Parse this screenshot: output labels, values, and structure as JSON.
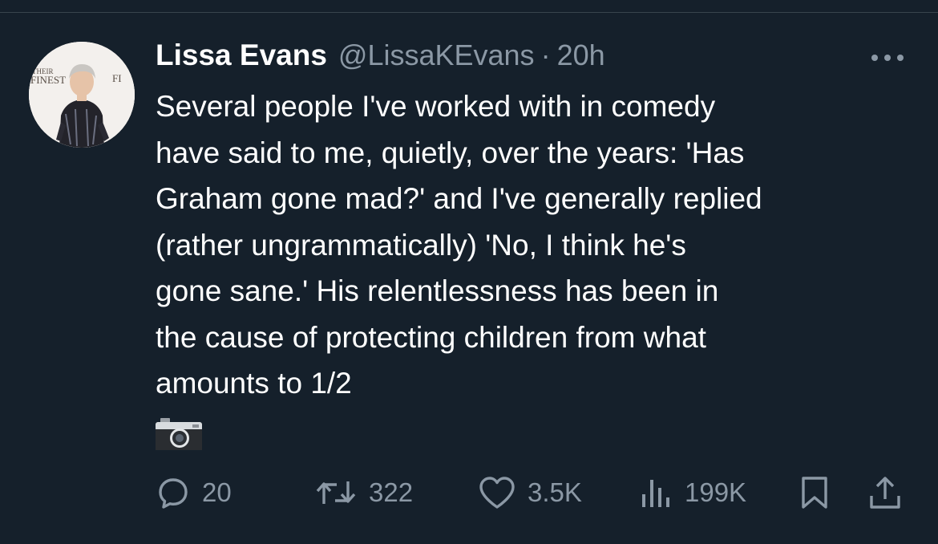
{
  "tweet": {
    "author_name": "Lissa Evans",
    "handle": "@LissaKEvans",
    "separator": "·",
    "timestamp": "20h",
    "text": "Several people I've worked with in comedy\nhave said to me, quietly, over the years: 'Has\nGraham gone mad?' and I've generally replied\n(rather ungrammatically) 'No, I think he's\ngone sane.' His relentlessness has been in\nthe cause of protecting children from what\namounts to 1/2",
    "media_icon": "camera-icon"
  },
  "actions": {
    "replies": "20",
    "retweets": "322",
    "likes": "3.5K",
    "views": "199K"
  },
  "colors": {
    "background": "#15202b",
    "text_primary": "#ffffff",
    "text_secondary": "#8b98a5"
  }
}
